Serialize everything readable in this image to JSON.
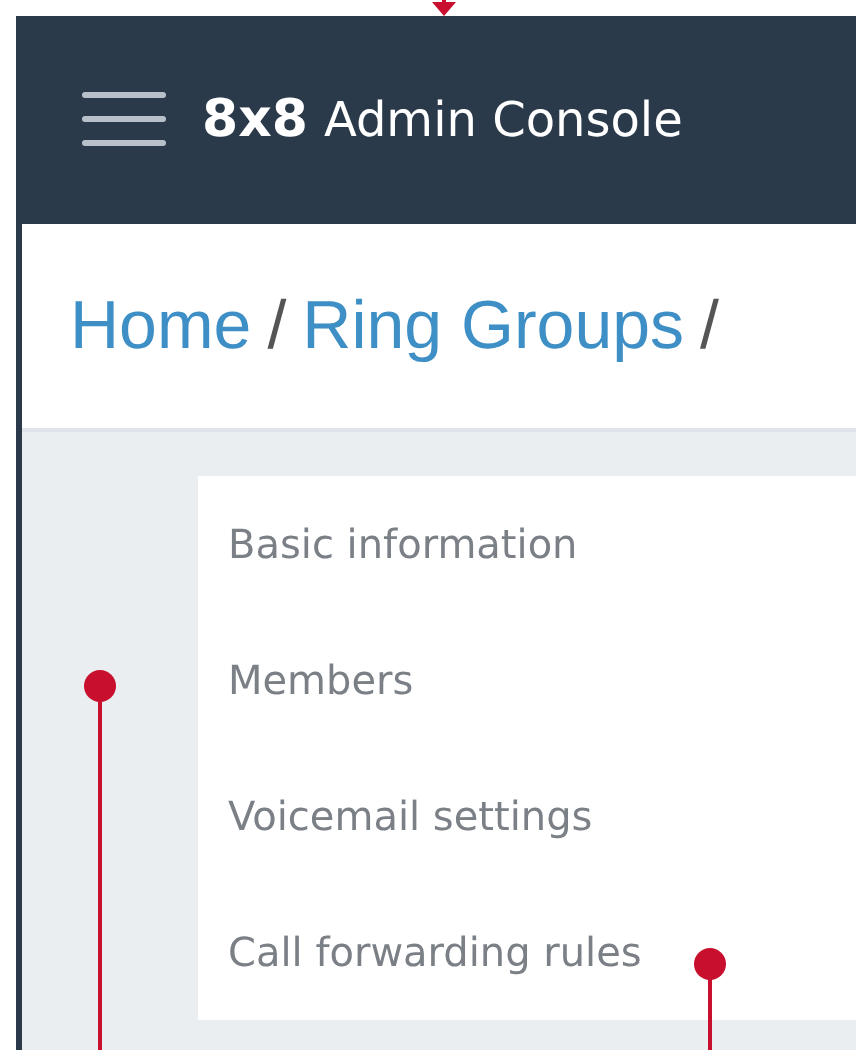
{
  "header": {
    "logo": "8x8",
    "title": "Admin Console"
  },
  "breadcrumb": {
    "separator": "/",
    "items": [
      "Home",
      "Ring Groups"
    ]
  },
  "menu": [
    "Basic information",
    "Members",
    "Voicemail settings",
    "Call forwarding rules"
  ]
}
